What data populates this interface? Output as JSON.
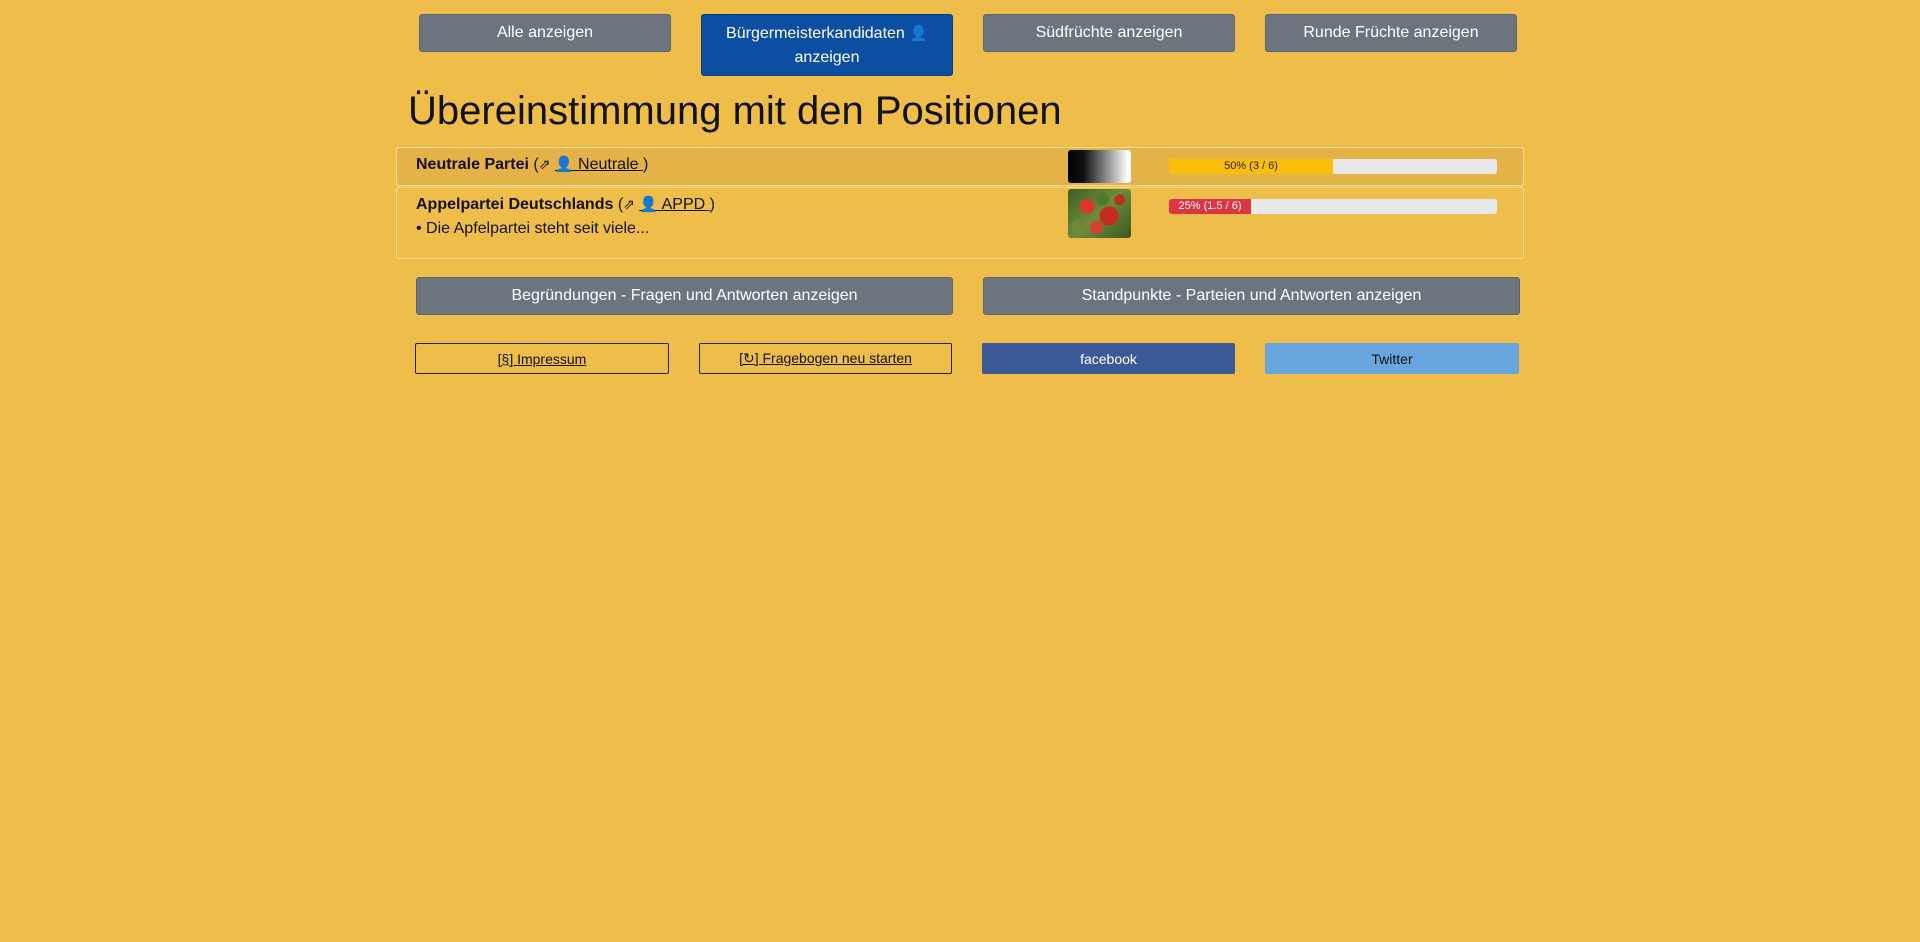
{
  "filters": {
    "all": "Alle anzeigen",
    "candidates_line1": "Bürgermeisterkandidaten",
    "candidates_person": "👤",
    "candidates_line2": "anzeigen",
    "tropical": "Südfrüchte anzeigen",
    "round": "Runde Früchte anzeigen"
  },
  "heading": "Übereinstimmung mit den Positionen",
  "parties": [
    {
      "name": "Neutrale Partei",
      "open_paren": "(",
      "arrow": "⇗",
      "person": "👤",
      "link": "Neutrale",
      "close_paren": ")",
      "description": "",
      "bar_label": "50% (3 / 6)",
      "bar_value": 0.5,
      "bar_color": "#fbbf0a"
    },
    {
      "name": "Appelpartei Deutschlands",
      "open_paren": "(",
      "arrow": "⇗",
      "person": "👤",
      "link": "APPD",
      "close_paren": ")",
      "description": "• Die Apfelpartei steht seit viele...",
      "bar_label": "25% (1.5 / 6)",
      "bar_value": 0.25,
      "bar_color": "#dc3545"
    }
  ],
  "buttons": {
    "reasons": "Begründungen - Fragen und Antworten anzeigen",
    "positions": "Standpunkte - Parteien und Antworten anzeigen"
  },
  "footer": {
    "imprint": "[§] Impressum",
    "restart": "[↻] Fragebogen neu starten",
    "facebook": "facebook",
    "twitter": "Twitter"
  }
}
